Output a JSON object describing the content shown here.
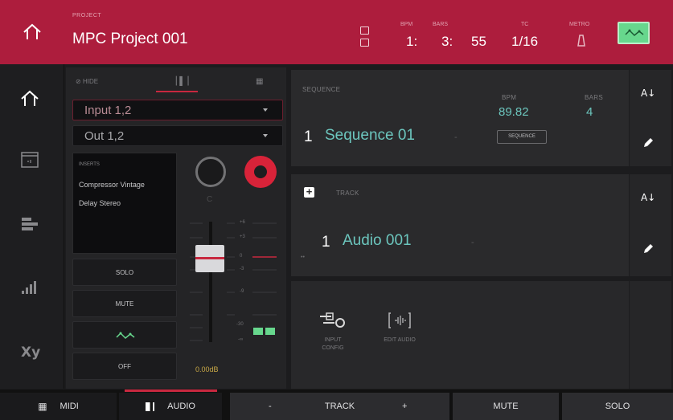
{
  "header": {
    "project_label": "PROJECT",
    "project_name": "MPC Project 001",
    "bpm_label": "BPM",
    "bars_label": "BARS",
    "pos_bar": "1:",
    "pos_beat": "3:",
    "pos_tick": "55",
    "tc_label": "TC",
    "tc_value": "1/16",
    "metro_label": "METRO"
  },
  "strip": {
    "tab_hide": "HIDE",
    "input": "Input 1,2",
    "output": "Out 1,2",
    "inserts_label": "INSERTS",
    "inserts": [
      "Compressor Vintage",
      "Delay Stereo"
    ],
    "pan_value": "C",
    "solo": "SOLO",
    "mute": "MUTE",
    "off": "OFF",
    "volume": "0.00dB",
    "scale": [
      "+6",
      "+3",
      "0",
      "-3",
      "-9",
      "-30",
      "-∞"
    ]
  },
  "sequence": {
    "label": "SEQUENCE",
    "number": "1",
    "name": "Sequence 01",
    "dash": "-",
    "bpm_label": "BPM",
    "bpm": "89.82",
    "bars_label": "BARS",
    "bars": "4",
    "chip": "SEQUENCE"
  },
  "track": {
    "label": "TRACK",
    "number": "1",
    "name": "Audio 001",
    "dash": "-"
  },
  "tools": {
    "input_config": "INPUT CONFIG",
    "edit_audio": "EDIT AUDIO"
  },
  "footer": {
    "midi": "MIDI",
    "audio": "AUDIO",
    "minus": "-",
    "track": "TRACK",
    "plus": "+",
    "mute": "MUTE",
    "solo": "SOLO"
  },
  "colors": {
    "accent": "#ad1d3d",
    "teal": "#6cc6be",
    "record": "#d82339",
    "automation": "#67d78d"
  }
}
